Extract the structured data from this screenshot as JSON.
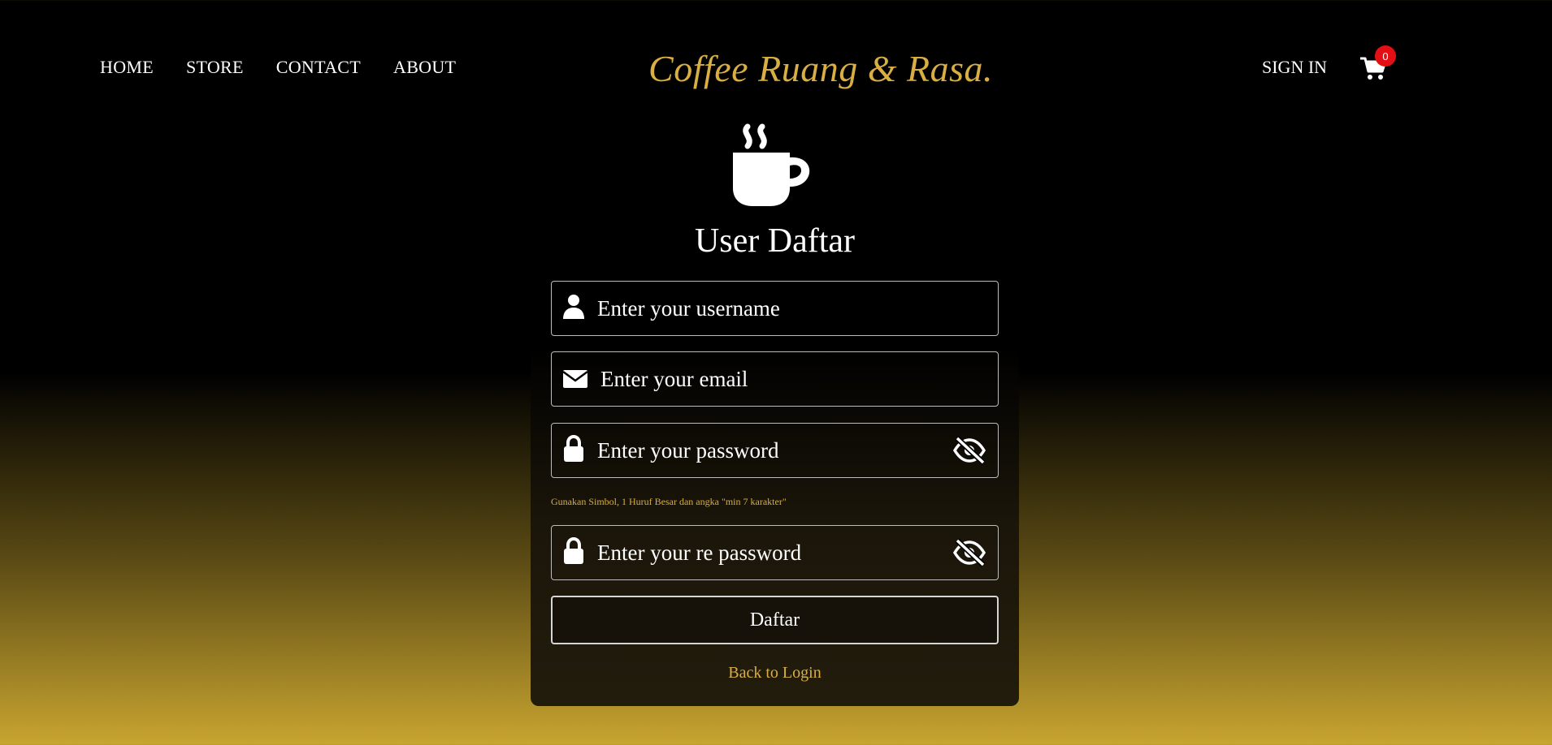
{
  "nav": {
    "links": [
      "HOME",
      "STORE",
      "CONTACT",
      "ABOUT"
    ],
    "brand": "Coffee Ruang & Rasa.",
    "sign_in": "SIGN IN",
    "cart_count": "0"
  },
  "form": {
    "title": "User Daftar",
    "username_placeholder": "Enter your username",
    "email_placeholder": "Enter your email",
    "password_placeholder": "Enter your password",
    "password_hint": "Gunakan Simbol, 1 Huruf Besar dan angka \"min 7 karakter\"",
    "repassword_placeholder": "Enter your re password",
    "submit_label": "Daftar",
    "back_link": "Back to Login"
  },
  "icons": {
    "hero": "coffee-cup-icon",
    "username": "user-icon",
    "email": "envelope-icon",
    "password": "lock-icon",
    "toggle": "eye-slash-icon",
    "cart": "shopping-cart-icon"
  },
  "colors": {
    "brand_gold": "#d9ae43",
    "badge_red": "#e30f14",
    "background_top": "#000000",
    "background_bottom": "#c9a530"
  }
}
